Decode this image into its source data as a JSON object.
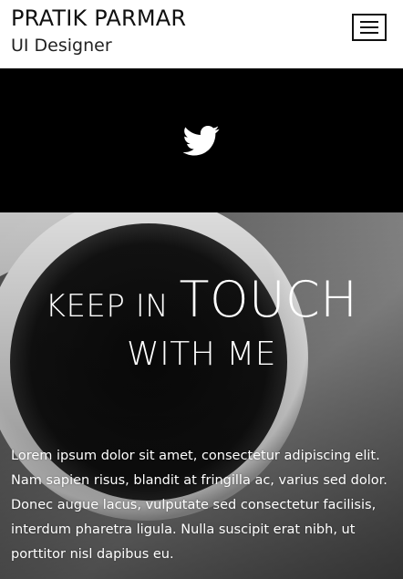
{
  "header": {
    "name": "PRATIK PARMAR",
    "role": "UI Designer",
    "menu_icon": "hamburger-menu-icon"
  },
  "social": {
    "icon": "twitter-icon",
    "color": "#ffffff",
    "band_color": "#000000"
  },
  "hero": {
    "title_small": "KEEP IN",
    "title_big": "TOUCH",
    "title_line2": "WITH ME",
    "body": "Lorem ipsum dolor sit amet, consectetur adipiscing elit. Nam sapien risus, blandit at fringilla ac, varius sed dolor. Donec augue lacus, vulputate sed consectetur facilisis, interdum pharetra ligula. Nulla suscipit erat nibh, ut porttitor nisl dapibus eu."
  }
}
